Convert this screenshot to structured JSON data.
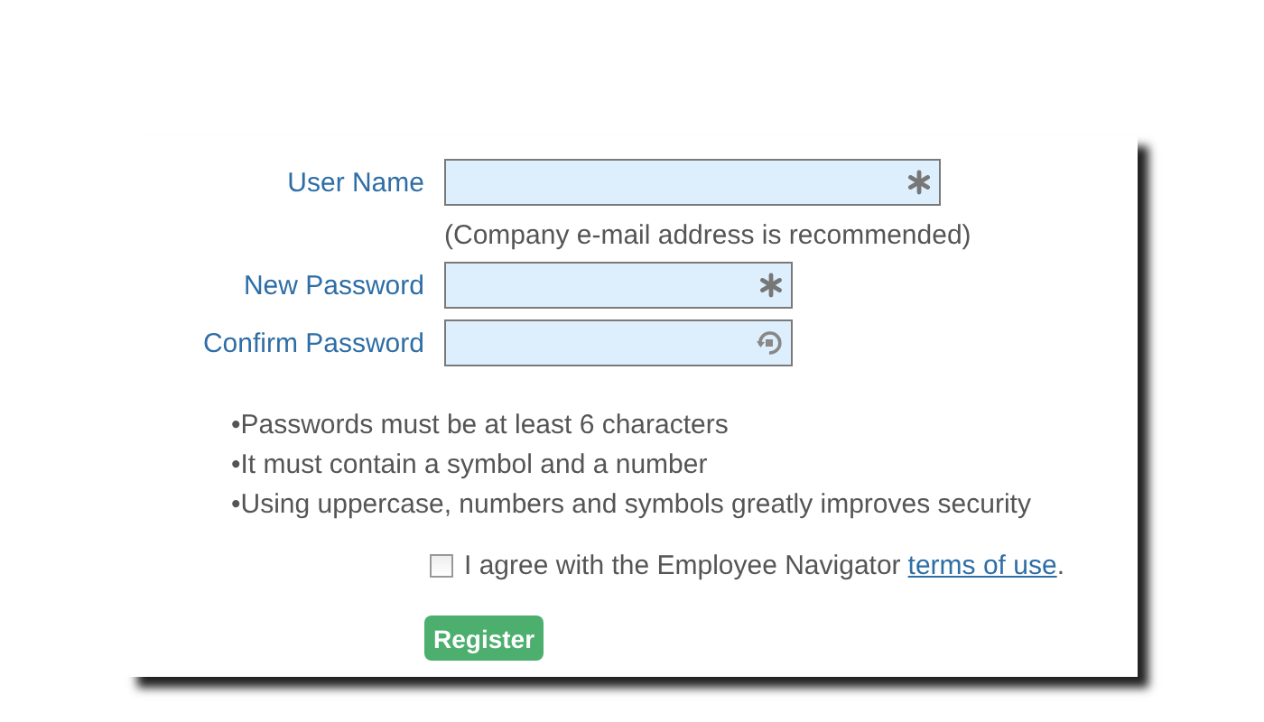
{
  "fields": [
    {
      "label": "User Name",
      "kind": "required",
      "wide": true,
      "hint": "(Company e-mail address is recommended)"
    },
    {
      "label": "New Password",
      "kind": "required",
      "wide": false
    },
    {
      "label": "Confirm Password",
      "kind": "match",
      "wide": false
    }
  ],
  "rules": [
    "•Passwords must be at least 6 characters",
    "•It must contain a symbol and a number",
    "•Using uppercase, numbers and symbols greatly improves security"
  ],
  "agreement": {
    "checked": false,
    "text": "I agree with the Employee Navigator",
    "link": "terms of use",
    "end": "."
  },
  "button": "Register"
}
